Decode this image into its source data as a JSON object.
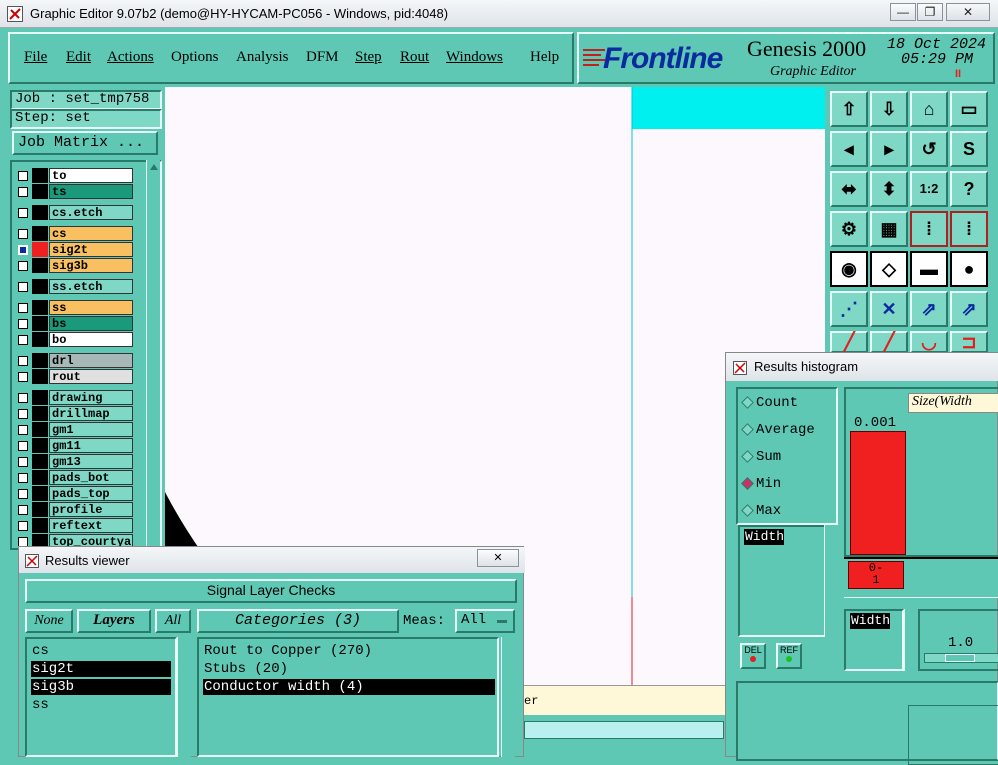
{
  "window": {
    "title": "Graphic Editor 9.07b2 (demo@HY-HYCAM-PC056 - Windows, pid:4048)",
    "min": "—",
    "max": "❐",
    "close": "✕"
  },
  "menu": [
    "File",
    "Edit",
    "Actions",
    "Options",
    "Analysis",
    "DFM",
    "Step",
    "Rout",
    "Windows",
    "Help"
  ],
  "brand": {
    "logo": "Frontline",
    "product": "Genesis 2000",
    "subtitle": "Graphic Editor",
    "date": "18 Oct 2024",
    "time": "05:29 PM",
    "pause": "II"
  },
  "job": {
    "job_label": "Job : set_tmp758",
    "step_label": "Step: set",
    "matrix_btn": "Job Matrix ..."
  },
  "layers": [
    {
      "name": "to",
      "color": "#ffffff",
      "group": 0
    },
    {
      "name": "ts",
      "color": "#1a9a7a",
      "group": 0
    },
    {
      "name": "cs.etch",
      "color": "#7fd8c6",
      "group": 1
    },
    {
      "name": "cs",
      "color": "#f8c060",
      "group": 2
    },
    {
      "name": "sig2t",
      "color": "#f8c060",
      "group": 2,
      "active": true
    },
    {
      "name": "sig3b",
      "color": "#f8c060",
      "group": 2
    },
    {
      "name": "ss.etch",
      "color": "#7fd8c6",
      "group": 3
    },
    {
      "name": "ss",
      "color": "#f8c060",
      "group": 4
    },
    {
      "name": "bs",
      "color": "#1a9a7a",
      "group": 4
    },
    {
      "name": "bo",
      "color": "#ffffff",
      "group": 4
    },
    {
      "name": "drl",
      "color": "#a8b8b8",
      "group": 5
    },
    {
      "name": "rout",
      "color": "#e0e0e0",
      "group": 5
    },
    {
      "name": "drawing",
      "color": "#7fd8c6",
      "group": 6
    },
    {
      "name": "drillmap",
      "color": "#7fd8c6",
      "group": 6
    },
    {
      "name": "gm1",
      "color": "#7fd8c6",
      "group": 6
    },
    {
      "name": "gm11",
      "color": "#7fd8c6",
      "group": 6
    },
    {
      "name": "gm13",
      "color": "#7fd8c6",
      "group": 6
    },
    {
      "name": "pads_bot",
      "color": "#7fd8c6",
      "group": 6
    },
    {
      "name": "pads_top",
      "color": "#7fd8c6",
      "group": 6
    },
    {
      "name": "profile",
      "color": "#7fd8c6",
      "group": 6
    },
    {
      "name": "reftext",
      "color": "#7fd8c6",
      "group": 6
    },
    {
      "name": "top_courtya",
      "color": "#7fd8c6",
      "group": 6
    }
  ],
  "histogram": {
    "title": "Results histogram",
    "modes": [
      "Count",
      "Average",
      "Sum",
      "Min",
      "Max"
    ],
    "selected_mode": "Min",
    "header": "Size(Width",
    "bar_value": "0.001",
    "bar_label": "0-\n1",
    "list_item": "Width",
    "field_label": "Width",
    "field_value": "1.0",
    "del_btn": "DEL",
    "ref_btn": "REF"
  },
  "viewer": {
    "title": "Results viewer",
    "heading": "Signal Layer Checks",
    "btn_none": "None",
    "btn_layers": "Layers",
    "btn_all": "All",
    "categories_label": "Categories (3)",
    "meas_label": "Meas:",
    "meas_value": "All",
    "layers": [
      "cs",
      "sig2t",
      "sig3b",
      "ss"
    ],
    "selected_layers": [
      "sig2t",
      "sig3b"
    ],
    "categories": [
      "Rout to Copper (270)",
      "Stubs (20)",
      "Conductor width (4)"
    ],
    "selected_category": "Conductor width (4)"
  },
  "status_fragment": "er",
  "colors": {
    "bg": "#5fc8b4",
    "canvas_white": "#fdf8fd",
    "cyan": "#00f0f0",
    "bar": "#f02020"
  }
}
